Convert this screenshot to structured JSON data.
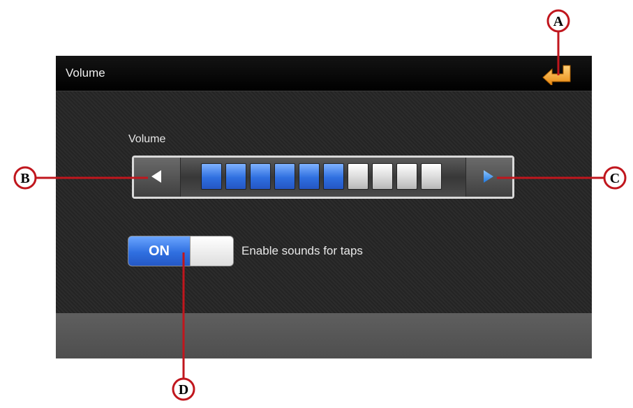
{
  "header": {
    "title": "Volume",
    "back_icon": "back-arrow-icon",
    "back_color": "#f5a31a"
  },
  "volume": {
    "label": "Volume",
    "level": 6,
    "max": 10,
    "decrease_icon": "left-arrow-icon",
    "increase_icon": "right-arrow-icon",
    "on_color": "#2f6fe0"
  },
  "tap_sounds": {
    "toggle_label": "ON",
    "state": "on",
    "description": "Enable sounds for taps"
  },
  "callouts": {
    "a": "A",
    "b": "B",
    "c": "C",
    "d": "D",
    "color": "#c0161d"
  }
}
